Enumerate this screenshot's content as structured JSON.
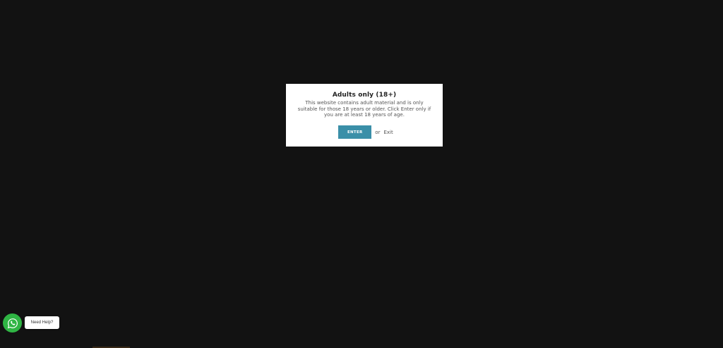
{
  "age_gate": {
    "title": "Adults only (18+)",
    "message": "This website contains adult material and is only suitable for those 18 years or older. Click Enter only if you are at least 18 years of age.",
    "enter_label": "ENTER",
    "or_label": "or",
    "exit_label": "Exit"
  },
  "chat_widget": {
    "icon": "whatsapp-icon",
    "help_label": "Need Help?"
  },
  "colors": {
    "background": "#121212",
    "modal_bg": "#ffffff",
    "enter_button": "#3a8fa8",
    "whatsapp_green": "#2fb544"
  }
}
